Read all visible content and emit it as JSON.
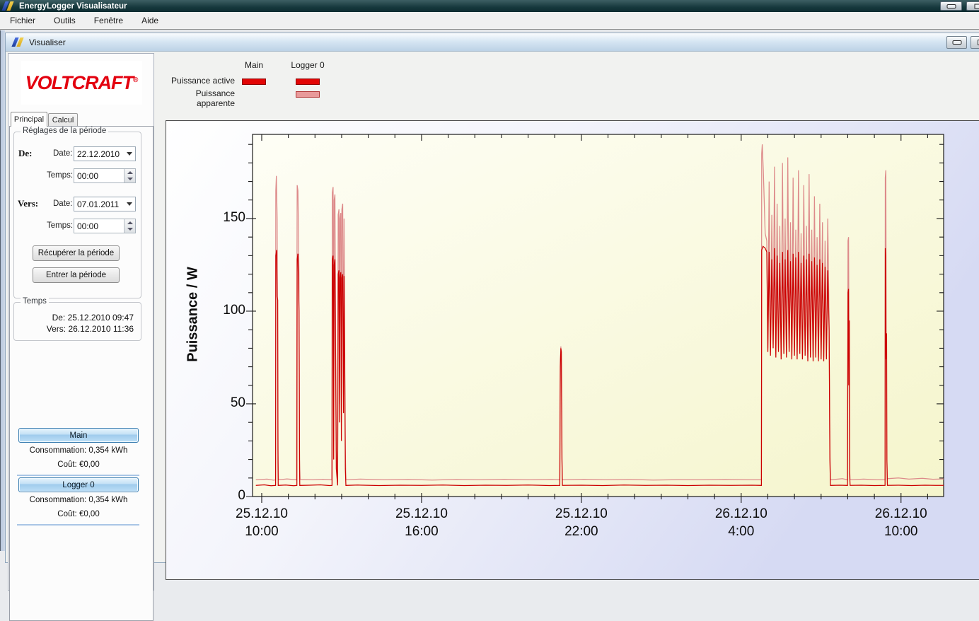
{
  "window": {
    "title": "EnergyLogger Visualisateur"
  },
  "menu": {
    "items": [
      {
        "label": "Fichier"
      },
      {
        "label": "Outils"
      },
      {
        "label": "Fenêtre"
      },
      {
        "label": "Aide"
      }
    ]
  },
  "inner_window": {
    "title": "Visualiser"
  },
  "sidebar": {
    "logo_text": "VOLTCRAFT",
    "logo_reg": "®",
    "tabs": [
      {
        "label": "Principal"
      },
      {
        "label": "Calcul"
      }
    ],
    "period_group": {
      "title": "Réglages de la période",
      "from_label": "De:",
      "to_label": "Vers:",
      "date_label": "Date:",
      "time_label": "Temps:",
      "from_date": "22.12.2010",
      "from_time": "00:00",
      "to_date": "07.01.2011",
      "to_time": "00:00",
      "fetch_button": "Récupérer la période",
      "enter_button": "Entrer la période"
    },
    "time_group": {
      "title": "Temps",
      "from": "De: 25.12.2010 09:47",
      "to": "Vers: 26.12.2010 11:36"
    },
    "loggers": [
      {
        "name": "Main",
        "consumption": "Consommation: 0,354 kWh",
        "cost": "Coût: €0,00"
      },
      {
        "name": "Logger 0",
        "consumption": "Consommation: 0,354 kWh",
        "cost": "Coût: €0,00"
      }
    ]
  },
  "legend": {
    "columns": [
      "Main",
      "Logger 0"
    ],
    "rows": [
      {
        "label": "Puissance active",
        "main": true,
        "logger0": true,
        "type": "active"
      },
      {
        "label": "Puissance apparente",
        "main": false,
        "logger0": true,
        "type": "apparent"
      }
    ]
  },
  "colors": {
    "active": "#cc0000",
    "apparent": "#dd8a8a",
    "plot_bg_light": "#fefef6",
    "plot_bg_yellow": "#f5f5cc"
  },
  "chart_data": {
    "type": "line",
    "ylabel": "Puissance / W",
    "x_unit": "hours since 25.12.2010 00:00",
    "x_range": [
      9.655,
      35.6
    ],
    "y_range": [
      0,
      195.4
    ],
    "x_major_ticks": [
      {
        "t": 10,
        "date": "25.12.10",
        "time": "10:00"
      },
      {
        "t": 16,
        "date": "25.12.10",
        "time": "16:00"
      },
      {
        "t": 22,
        "date": "25.12.10",
        "time": "22:00"
      },
      {
        "t": 28,
        "date": "26.12.10",
        "time": "4:00"
      },
      {
        "t": 34,
        "date": "26.12.10",
        "time": "10:00"
      }
    ],
    "x_minor_step": 1,
    "y_major_ticks": [
      0,
      50,
      100,
      150
    ],
    "y_minor_step": 10,
    "legend_position": "top-left-above-plot",
    "grid": false,
    "series": [
      {
        "name": "Puissance apparente (Logger 0)",
        "color": "#dd8a8a",
        "points": [
          [
            9.78,
            9
          ],
          [
            10.2,
            9.4
          ],
          [
            10.45,
            8.8
          ],
          [
            10.52,
            9
          ],
          [
            10.53,
            165
          ],
          [
            10.55,
            173
          ],
          [
            10.58,
            150
          ],
          [
            10.61,
            25
          ],
          [
            10.63,
            9
          ],
          [
            10.95,
            9.5
          ],
          [
            11.31,
            9
          ],
          [
            11.33,
            168
          ],
          [
            11.36,
            165
          ],
          [
            11.4,
            120
          ],
          [
            11.42,
            20
          ],
          [
            11.44,
            9.2
          ],
          [
            11.9,
            9
          ],
          [
            12.3,
            9.3
          ],
          [
            12.63,
            9
          ],
          [
            12.65,
            164
          ],
          [
            12.68,
            167
          ],
          [
            12.7,
            30
          ],
          [
            12.72,
            160
          ],
          [
            12.75,
            163
          ],
          [
            12.78,
            70
          ],
          [
            12.8,
            25
          ],
          [
            12.85,
            9
          ],
          [
            12.87,
            152
          ],
          [
            12.9,
            155
          ],
          [
            12.92,
            50
          ],
          [
            12.94,
            150
          ],
          [
            12.97,
            153
          ],
          [
            12.99,
            40
          ],
          [
            13.01,
            155
          ],
          [
            13.04,
            158
          ],
          [
            13.07,
            55
          ],
          [
            13.09,
            150
          ],
          [
            13.12,
            70
          ],
          [
            13.14,
            25
          ],
          [
            13.16,
            9
          ],
          [
            13.7,
            9.4
          ],
          [
            14.6,
            9
          ],
          [
            15.5,
            9.2
          ],
          [
            16.4,
            8.9
          ],
          [
            17.3,
            9.2
          ],
          [
            18.2,
            9
          ],
          [
            19.1,
            9.3
          ],
          [
            20,
            9
          ],
          [
            20.9,
            9.2
          ],
          [
            21.19,
            9
          ],
          [
            21.21,
            74
          ],
          [
            21.23,
            81
          ],
          [
            21.26,
            50
          ],
          [
            21.28,
            9
          ],
          [
            22.1,
            9.3
          ],
          [
            22.9,
            9
          ],
          [
            23.8,
            9.2
          ],
          [
            24.7,
            8.9
          ],
          [
            25.6,
            9.1
          ],
          [
            26.5,
            9
          ],
          [
            27.4,
            9.2
          ],
          [
            28.3,
            9
          ],
          [
            28.76,
            9
          ],
          [
            28.77,
            185
          ],
          [
            28.79,
            190
          ],
          [
            28.83,
            176
          ],
          [
            28.9,
            142
          ],
          [
            28.96,
            138
          ],
          [
            29,
            80
          ],
          [
            29.05,
            170
          ],
          [
            29.1,
            78
          ],
          [
            29.15,
            152
          ],
          [
            29.2,
            82
          ],
          [
            29.25,
            178
          ],
          [
            29.3,
            77
          ],
          [
            29.35,
            158
          ],
          [
            29.4,
            80
          ],
          [
            29.45,
            146
          ],
          [
            29.5,
            76
          ],
          [
            29.55,
            180
          ],
          [
            29.6,
            79
          ],
          [
            29.65,
            150
          ],
          [
            29.7,
            77
          ],
          [
            29.75,
            183
          ],
          [
            29.8,
            80
          ],
          [
            29.85,
            148
          ],
          [
            29.9,
            76
          ],
          [
            29.95,
            172
          ],
          [
            30,
            78
          ],
          [
            30.05,
            144
          ],
          [
            30.1,
            76
          ],
          [
            30.15,
            176
          ],
          [
            30.2,
            79
          ],
          [
            30.25,
            142
          ],
          [
            30.3,
            76
          ],
          [
            30.35,
            168
          ],
          [
            30.4,
            78
          ],
          [
            30.45,
            146
          ],
          [
            30.5,
            75
          ],
          [
            30.55,
            174
          ],
          [
            30.6,
            77
          ],
          [
            30.65,
            144
          ],
          [
            30.7,
            75
          ],
          [
            30.75,
            162
          ],
          [
            30.8,
            77
          ],
          [
            30.85,
            140
          ],
          [
            30.9,
            75
          ],
          [
            30.95,
            158
          ],
          [
            31,
            76
          ],
          [
            31.05,
            148
          ],
          [
            31.1,
            75
          ],
          [
            31.15,
            138
          ],
          [
            31.2,
            76
          ],
          [
            31.25,
            150
          ],
          [
            31.3,
            95
          ],
          [
            31.33,
            25
          ],
          [
            31.35,
            9
          ],
          [
            31.8,
            9.6
          ],
          [
            31.99,
            9
          ],
          [
            32.01,
            138
          ],
          [
            32.03,
            140
          ],
          [
            32.05,
            70
          ],
          [
            32.07,
            15
          ],
          [
            32.09,
            9
          ],
          [
            32.6,
            9.4
          ],
          [
            33.1,
            9
          ],
          [
            33.4,
            9
          ],
          [
            33.41,
            172
          ],
          [
            33.43,
            176
          ],
          [
            33.45,
            70
          ],
          [
            33.47,
            20
          ],
          [
            33.49,
            9.6
          ],
          [
            33.9,
            10
          ],
          [
            34.3,
            9.4
          ],
          [
            34.8,
            9.8
          ],
          [
            35.2,
            9.3
          ],
          [
            35.6,
            9.5
          ]
        ]
      },
      {
        "name": "Puissance active (Main / Logger 0)",
        "color": "#cc0000",
        "points": [
          [
            9.78,
            6
          ],
          [
            10.1,
            6.3
          ],
          [
            10.35,
            5.8
          ],
          [
            10.52,
            6
          ],
          [
            10.53,
            130
          ],
          [
            10.56,
            133
          ],
          [
            10.58,
            108
          ],
          [
            10.6,
            106
          ],
          [
            10.61,
            18
          ],
          [
            10.62,
            6
          ],
          [
            10.9,
            6.2
          ],
          [
            11.2,
            5.8
          ],
          [
            11.32,
            6
          ],
          [
            11.33,
            128
          ],
          [
            11.36,
            131
          ],
          [
            11.38,
            112
          ],
          [
            11.4,
            100
          ],
          [
            11.42,
            15
          ],
          [
            11.43,
            6
          ],
          [
            11.8,
            6.1
          ],
          [
            12.2,
            6.3
          ],
          [
            12.55,
            5.9
          ],
          [
            12.64,
            6
          ],
          [
            12.65,
            128
          ],
          [
            12.68,
            130
          ],
          [
            12.7,
            20
          ],
          [
            12.72,
            125
          ],
          [
            12.75,
            128
          ],
          [
            12.78,
            60
          ],
          [
            12.8,
            15
          ],
          [
            12.85,
            6
          ],
          [
            12.87,
            120
          ],
          [
            12.9,
            122
          ],
          [
            12.92,
            40
          ],
          [
            12.94,
            118
          ],
          [
            12.97,
            121
          ],
          [
            12.99,
            30
          ],
          [
            13.01,
            118
          ],
          [
            13.04,
            120
          ],
          [
            13.07,
            45
          ],
          [
            13.09,
            119
          ],
          [
            13.12,
            60
          ],
          [
            13.14,
            15
          ],
          [
            13.16,
            6
          ],
          [
            13.6,
            6.2
          ],
          [
            14.4,
            5.9
          ],
          [
            15.2,
            6.1
          ],
          [
            16,
            6
          ],
          [
            16.8,
            6.2
          ],
          [
            17.6,
            5.9
          ],
          [
            18.4,
            6.1
          ],
          [
            19.2,
            6
          ],
          [
            20,
            6.2
          ],
          [
            20.8,
            5.9
          ],
          [
            21.19,
            6
          ],
          [
            21.21,
            70
          ],
          [
            21.23,
            80
          ],
          [
            21.25,
            78
          ],
          [
            21.27,
            20
          ],
          [
            21.29,
            6
          ],
          [
            22,
            6.1
          ],
          [
            22.8,
            5.9
          ],
          [
            23.6,
            6.2
          ],
          [
            24.4,
            6
          ],
          [
            25.2,
            6.1
          ],
          [
            26,
            5.9
          ],
          [
            26.8,
            6.1
          ],
          [
            27.6,
            6
          ],
          [
            28.4,
            6.1
          ],
          [
            28.76,
            6
          ],
          [
            28.77,
            133
          ],
          [
            28.82,
            135
          ],
          [
            28.9,
            134
          ],
          [
            28.96,
            132
          ],
          [
            29,
            78
          ],
          [
            29.05,
            132
          ],
          [
            29.1,
            76
          ],
          [
            29.15,
            128
          ],
          [
            29.2,
            80
          ],
          [
            29.25,
            134
          ],
          [
            29.3,
            75
          ],
          [
            29.35,
            130
          ],
          [
            29.4,
            78
          ],
          [
            29.45,
            126
          ],
          [
            29.5,
            74
          ],
          [
            29.55,
            132
          ],
          [
            29.6,
            77
          ],
          [
            29.65,
            128
          ],
          [
            29.7,
            75
          ],
          [
            29.75,
            133
          ],
          [
            29.8,
            78
          ],
          [
            29.85,
            127
          ],
          [
            29.9,
            74
          ],
          [
            29.95,
            131
          ],
          [
            30,
            76
          ],
          [
            30.05,
            129
          ],
          [
            30.1,
            74
          ],
          [
            30.15,
            132
          ],
          [
            30.2,
            77
          ],
          [
            30.25,
            126
          ],
          [
            30.3,
            74
          ],
          [
            30.35,
            130
          ],
          [
            30.4,
            76
          ],
          [
            30.45,
            128
          ],
          [
            30.5,
            73
          ],
          [
            30.55,
            131
          ],
          [
            30.6,
            75
          ],
          [
            30.65,
            127
          ],
          [
            30.7,
            73
          ],
          [
            30.75,
            129
          ],
          [
            30.8,
            75
          ],
          [
            30.85,
            125
          ],
          [
            30.9,
            73
          ],
          [
            30.95,
            128
          ],
          [
            31,
            74
          ],
          [
            31.05,
            126
          ],
          [
            31.1,
            73
          ],
          [
            31.15,
            124
          ],
          [
            31.2,
            74
          ],
          [
            31.25,
            122
          ],
          [
            31.3,
            90
          ],
          [
            31.33,
            20
          ],
          [
            31.35,
            6
          ],
          [
            31.7,
            6.1
          ],
          [
            31.99,
            6
          ],
          [
            32.01,
            110
          ],
          [
            32.03,
            112
          ],
          [
            32.04,
            60
          ],
          [
            32.06,
            95
          ],
          [
            32.07,
            12
          ],
          [
            32.09,
            6
          ],
          [
            32.5,
            6.1
          ],
          [
            33,
            5.9
          ],
          [
            33.4,
            6
          ],
          [
            33.41,
            134
          ],
          [
            33.42,
            130
          ],
          [
            33.43,
            90
          ],
          [
            33.45,
            74
          ],
          [
            33.46,
            88
          ],
          [
            33.47,
            20
          ],
          [
            33.49,
            6
          ],
          [
            33.9,
            6.1
          ],
          [
            34.4,
            5.9
          ],
          [
            34.9,
            6.1
          ],
          [
            35.3,
            6
          ],
          [
            35.6,
            6
          ]
        ]
      }
    ]
  }
}
